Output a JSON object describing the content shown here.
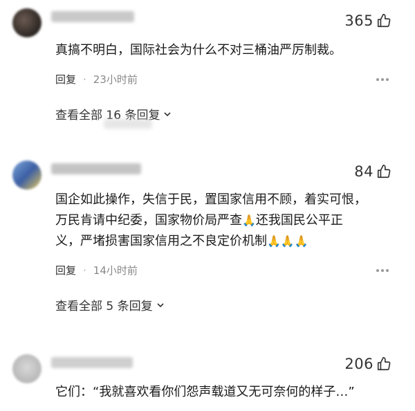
{
  "comments": [
    {
      "likes": "365",
      "text": "真搞不明白，国际社会为什么不对三桶油严厉制裁。",
      "reply_label": "回复",
      "time": "23小时前",
      "view_replies": "查看全部 16 条回复"
    },
    {
      "likes": "84",
      "text_lines": [
        "国企如此操作，失信于民，置国家信用不顾，着实可恨，",
        "万民肯请中纪委，国家物价局严查",
        "还我国民公平正",
        "义，严堵损害国家信用之不良定价机制"
      ],
      "reply_label": "回复",
      "time": "14小时前",
      "view_replies": "查看全部 5 条回复"
    },
    {
      "likes": "206",
      "text": "它们：“我就喜欢看你们怨声载道又无可奈何的样子…”"
    }
  ],
  "icons": {
    "like": "thumbs-up-icon",
    "more": "more-horizontal-icon",
    "chevron": "chevron-down-icon",
    "pray": "folded-hands-icon"
  },
  "colors": {
    "text": "#1a1a1a",
    "meta": "#888888",
    "pray": "#e9a48c"
  }
}
